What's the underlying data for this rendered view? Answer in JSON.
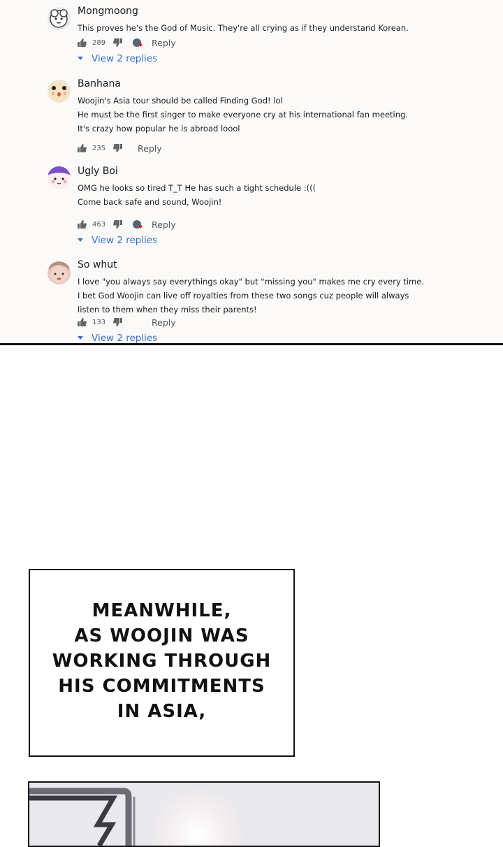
{
  "comments": [
    {
      "author": "Mongmoong",
      "lines": [
        "This proves he's the God of Music. They're all crying as if they understand Korean."
      ],
      "likes": "289",
      "reply_label": "Reply",
      "view_replies": "View 2 replies"
    },
    {
      "author": "Banhana",
      "lines": [
        "Woojin's Asia tour should be called Finding God! lol",
        "He must be the first singer to make everyone cry at his international fan meeting.",
        "It's crazy how popular he is abroad loool"
      ],
      "likes": "235",
      "reply_label": "Reply"
    },
    {
      "author": "Ugly Boi",
      "lines": [
        "OMG he looks so tired T_T He has such a tight schedule :(((",
        "Come back safe and sound, Woojin!"
      ],
      "likes": "463",
      "reply_label": "Reply",
      "view_replies": "View 2 replies"
    },
    {
      "author": "So whut",
      "lines": [
        "I love \"you always say everythings okay\" but \"missing you\" makes me cry every time.",
        "I bet God Woojin can live off royalties from these two songs cuz people will always",
        "listen to them when they miss their parents!"
      ],
      "likes": "133",
      "reply_label": "Reply",
      "view_replies": "View 2 replies"
    }
  ],
  "caption": {
    "lines": [
      "MEANWHILE,",
      "AS WOOJIN WAS",
      "WORKING THROUGH",
      "HIS COMMITMENTS",
      "IN ASIA,"
    ]
  },
  "colors": {
    "link": "#3a6fd0",
    "heart": "#e0202a",
    "text": "#1a1a1a",
    "comment_bg": "#fbfaf8"
  }
}
